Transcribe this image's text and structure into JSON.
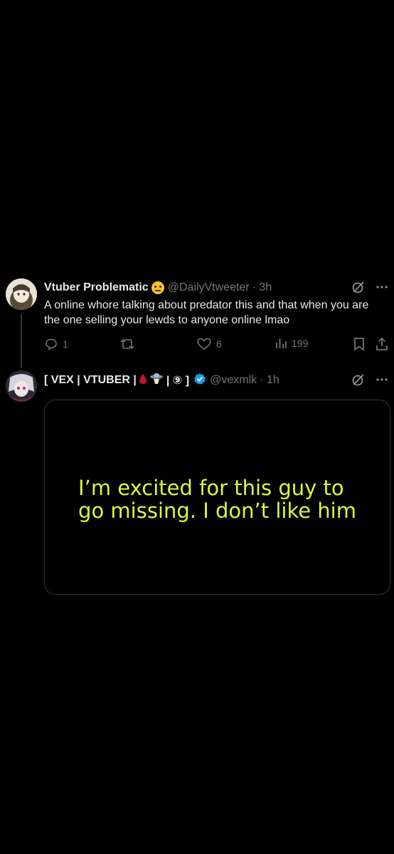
{
  "tweets": [
    {
      "name": "Vtuber Problematic",
      "name_emoji": "thinking-face-emoji",
      "handle": "@DailyVtweeter",
      "time": "· 3h",
      "text": "A online whore talking about predator this and that when you are the one selling your lewds to anyone online lmao",
      "replies": "1",
      "likes": "6",
      "views": "199"
    },
    {
      "name": "[ VEX | VTUBER |",
      "name_suffix": "| ⑨ ]",
      "handle": "@vexmlk",
      "time": "· 1h",
      "verified": true,
      "media_line1": "I’m excited for this guy to",
      "media_line2": "go missing. I don’t like him"
    }
  ],
  "colors": {
    "background": "#000000",
    "text": "#e7e9ea",
    "muted": "#71767b",
    "verified": "#1d9bf0",
    "media_text": "#dcf542"
  }
}
